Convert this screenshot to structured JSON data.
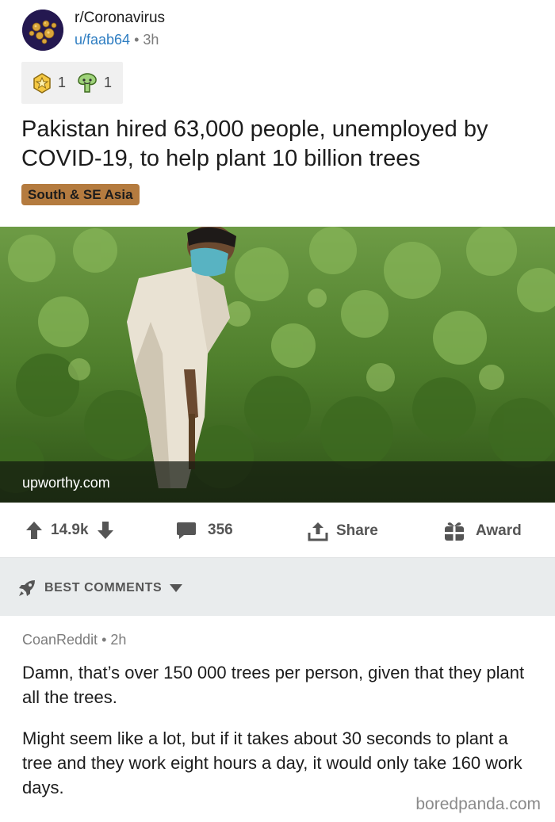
{
  "post": {
    "subreddit": "r/Coronavirus",
    "author": "u/faab64",
    "separator": "•",
    "age": "3h",
    "awards": [
      {
        "icon": "star-award-icon",
        "count": "1"
      },
      {
        "icon": "wholesome-award-icon",
        "count": "1"
      }
    ],
    "title": "Pakistan hired 63,000 people, unemployed by COVID-19, to help plant 10 billion trees",
    "flair": "South & SE Asia",
    "link_domain": "upworthy.com"
  },
  "actions": {
    "score": "14.9k",
    "comments": "356",
    "share_label": "Share",
    "award_label": "Award"
  },
  "sort": {
    "label": "BEST COMMENTS"
  },
  "comment": {
    "author": "CoanReddit",
    "separator": "•",
    "age": "2h",
    "paragraph1": "Damn, that’s over 150 000 trees per person, given that they plant all the trees.",
    "paragraph2": "Might seem like a lot, but if it takes about 30 seconds to plant a tree and they work eight hours a day, it would only take 160 work days."
  },
  "watermark": "boredpanda.com",
  "colors": {
    "link_blue": "#2f7ec2",
    "flair_bg": "#b47b3f",
    "sort_bar_bg": "#e9eced",
    "foliage": "#4f7a2e"
  }
}
